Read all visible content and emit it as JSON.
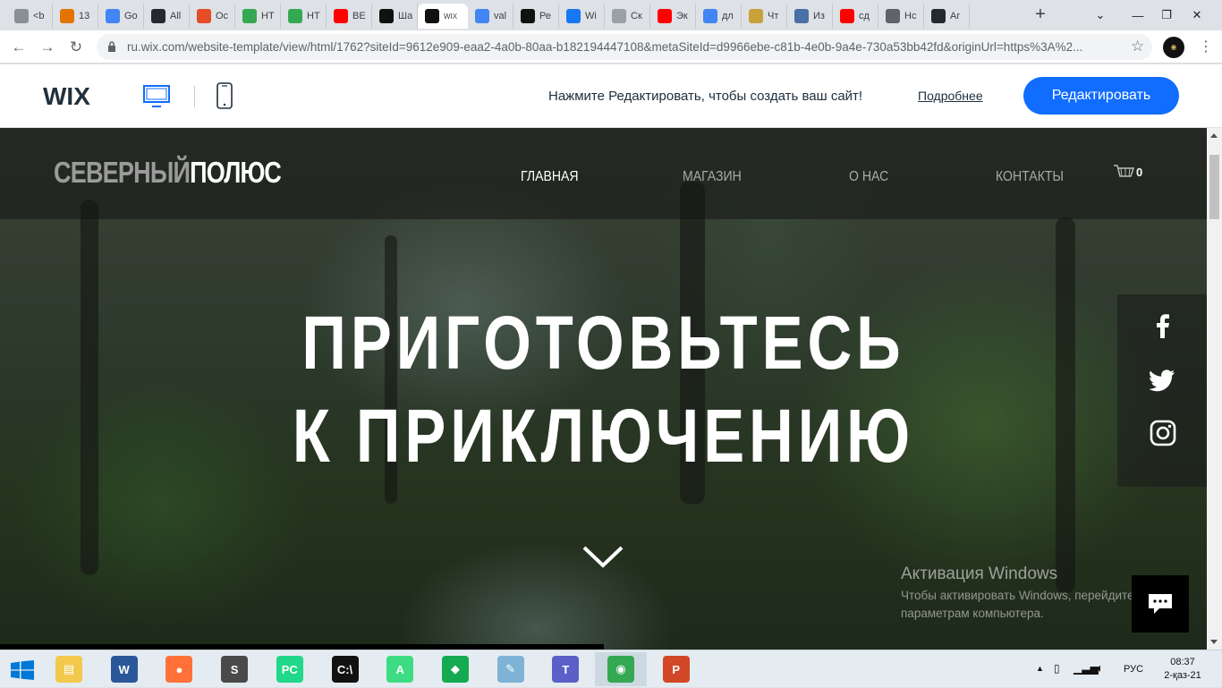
{
  "browser": {
    "tabs": [
      {
        "label": "<b",
        "fav": "globe-icon",
        "color": "#8a8f96"
      },
      {
        "label": "13",
        "fav": "orange-icon",
        "color": "#e37400"
      },
      {
        "label": "Go",
        "fav": "translate-icon",
        "color": "#4285f4"
      },
      {
        "label": "All",
        "fav": "github-icon",
        "color": "#24292e"
      },
      {
        "label": "Ос",
        "fav": "html5-icon",
        "color": "#e44d26"
      },
      {
        "label": "НТ",
        "fav": "check-icon",
        "color": "#34a853"
      },
      {
        "label": "НТ",
        "fav": "check-icon",
        "color": "#34a853"
      },
      {
        "label": "ВЕ",
        "fav": "youtube-icon",
        "color": "#ff0000"
      },
      {
        "label": "Ша",
        "fav": "wix-icon",
        "color": "#111111"
      },
      {
        "label": "Wix",
        "fav": "wix-icon",
        "color": "#111111",
        "active": true
      },
      {
        "label": "val",
        "fav": "google-icon",
        "color": "#4285f4"
      },
      {
        "label": "Ре",
        "fav": "wix-icon",
        "color": "#111111"
      },
      {
        "label": "Wi",
        "fav": "facebook-icon",
        "color": "#1877f2"
      },
      {
        "label": "Ск",
        "fav": "x-icon",
        "color": "#9aa0a6"
      },
      {
        "label": "Эк",
        "fav": "youtube-icon",
        "color": "#ff0000"
      },
      {
        "label": "дл",
        "fav": "google-icon",
        "color": "#4285f4"
      },
      {
        "label": "Чт",
        "fav": "coin-icon",
        "color": "#c9a13b"
      },
      {
        "label": "Из",
        "fav": "gear-icon",
        "color": "#4a6fa5"
      },
      {
        "label": "сд",
        "fav": "youtube-icon",
        "color": "#ff0000"
      },
      {
        "label": "Нс",
        "fav": "globe-icon",
        "color": "#5f6368"
      },
      {
        "label": "Ar",
        "fav": "github-icon",
        "color": "#24292e"
      }
    ],
    "active_tab_text": "WIX",
    "url": "ru.wix.com/website-template/view/html/1762?siteId=9612e909-eaa2-4a0b-80aa-b182194447108&metaSiteId=d9966ebe-c81b-4e0b-9a4e-730a53bb42fd&originUrl=https%3A%2..."
  },
  "wixbar": {
    "logo": "WIX",
    "promo": "Нажмите Редактировать, чтобы создать ваш сайт!",
    "learn_more": "Подробнее",
    "edit_button": "Редактировать"
  },
  "site": {
    "logo_part1": "СЕВЕРНЫЙ",
    "logo_part2": "ПОЛЮС",
    "nav": [
      "ГЛАВНАЯ",
      "МАГАЗИН",
      "О НАС",
      "КОНТАКТЫ"
    ],
    "cart_count": "0",
    "headline_line1": "ПРИГОТОВЬТЕСЬ",
    "headline_line2": "К ПРИКЛЮЧЕНИЮ",
    "social": [
      "facebook-icon",
      "twitter-icon",
      "instagram-icon"
    ]
  },
  "windows_activation": {
    "title": "Активация Windows",
    "subtitle": "Чтобы активировать Windows, перейдите к параметрам компьютера."
  },
  "taskbar": {
    "apps": [
      {
        "name": "file-explorer-icon",
        "color": "#f2c94c",
        "glyph": "▤"
      },
      {
        "name": "word-icon",
        "color": "#2b579a",
        "glyph": "W"
      },
      {
        "name": "firefox-icon",
        "color": "#ff7139",
        "glyph": "●"
      },
      {
        "name": "sublime-icon",
        "color": "#4a4a4a",
        "glyph": "S"
      },
      {
        "name": "pycharm-icon",
        "color": "#21d789",
        "glyph": "PC"
      },
      {
        "name": "cmd-icon",
        "color": "#111111",
        "glyph": "C:\\"
      },
      {
        "name": "android-studio-icon",
        "color": "#3ddc84",
        "glyph": "A"
      },
      {
        "name": "mongodb-icon",
        "color": "#13aa52",
        "glyph": "◆"
      },
      {
        "name": "notepad-icon",
        "color": "#7fb3d5",
        "glyph": "✎"
      },
      {
        "name": "teams-icon",
        "color": "#5b5fc7",
        "glyph": "T"
      },
      {
        "name": "chrome-icon",
        "color": "#34a853",
        "glyph": "◉"
      },
      {
        "name": "powerpoint-icon",
        "color": "#d24726",
        "glyph": "P"
      }
    ],
    "lang": "РУС",
    "time": "08:37",
    "date": "2-қаз-21"
  }
}
